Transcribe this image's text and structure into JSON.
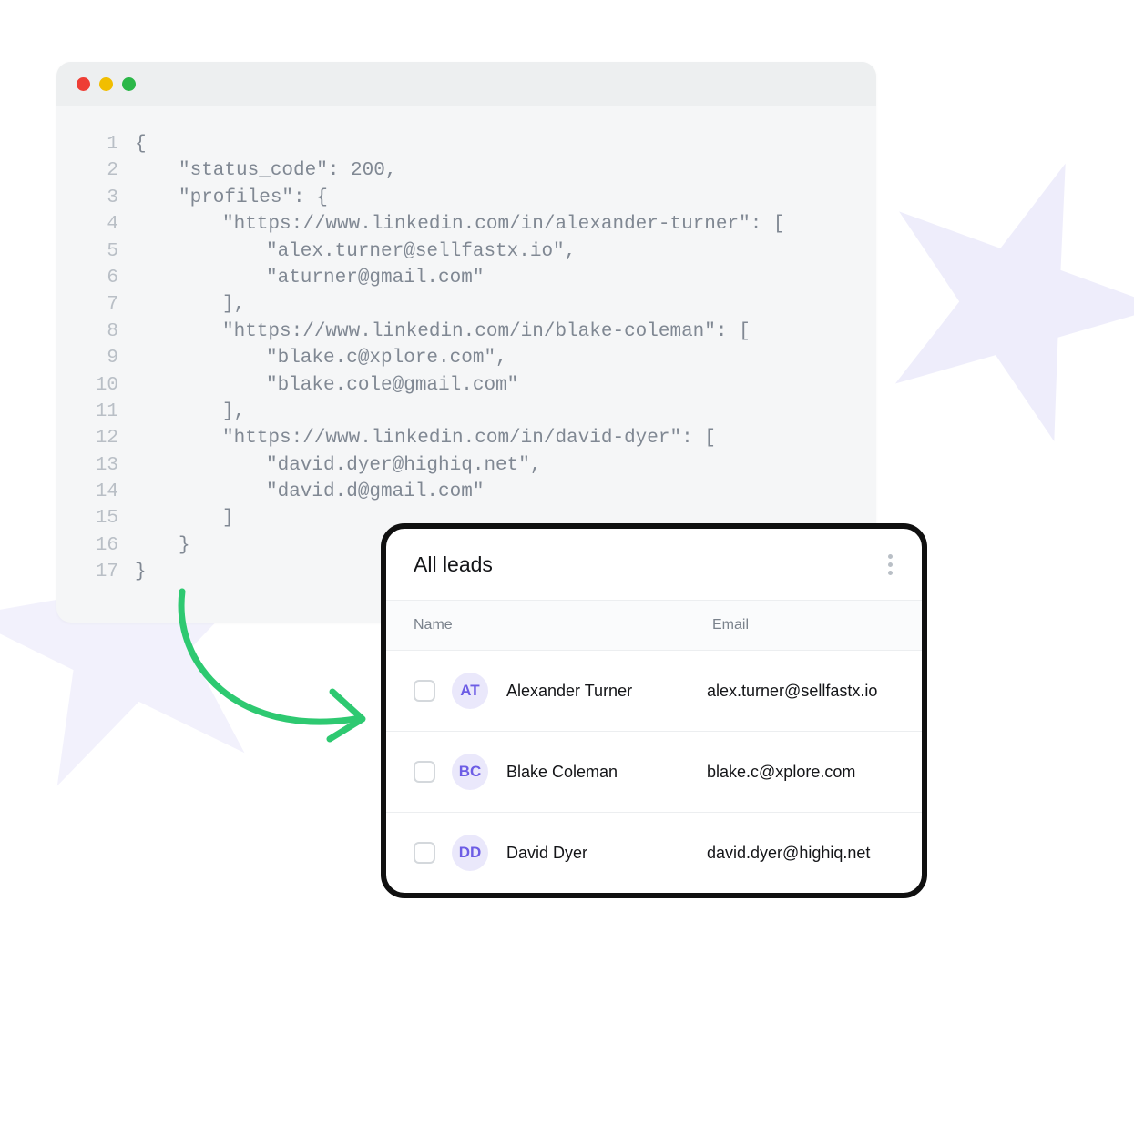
{
  "code": {
    "lines": [
      {
        "n": "1",
        "indent": 1,
        "text": "{"
      },
      {
        "n": "2",
        "indent": 2,
        "text": "\"status_code\": 200,"
      },
      {
        "n": "3",
        "indent": 2,
        "text": "\"profiles\": {"
      },
      {
        "n": "4",
        "indent": 3,
        "text": "\"https://www.linkedin.com/in/alexander-turner\": ["
      },
      {
        "n": "5",
        "indent": 4,
        "text": "\"alex.turner@sellfastx.io\","
      },
      {
        "n": "6",
        "indent": 4,
        "text": "\"aturner@gmail.com\""
      },
      {
        "n": "7",
        "indent": 3,
        "text": "],"
      },
      {
        "n": "8",
        "indent": 3,
        "text": "\"https://www.linkedin.com/in/blake-coleman\": ["
      },
      {
        "n": "9",
        "indent": 4,
        "text": "\"blake.c@xplore.com\","
      },
      {
        "n": "10",
        "indent": 4,
        "text": "\"blake.cole@gmail.com\""
      },
      {
        "n": "11",
        "indent": 3,
        "text": "],"
      },
      {
        "n": "12",
        "indent": 3,
        "text": "\"https://www.linkedin.com/in/david-dyer\": ["
      },
      {
        "n": "13",
        "indent": 4,
        "text": "\"david.dyer@highiq.net\","
      },
      {
        "n": "14",
        "indent": 4,
        "text": "\"david.d@gmail.com\""
      },
      {
        "n": "15",
        "indent": 3,
        "text": "]"
      },
      {
        "n": "16",
        "indent": 2,
        "text": "}"
      },
      {
        "n": "17",
        "indent": 1,
        "text": "}"
      }
    ]
  },
  "leads": {
    "title": "All leads",
    "columns": {
      "name": "Name",
      "email": "Email"
    },
    "rows": [
      {
        "initials": "AT",
        "name": "Alexander Turner",
        "email": "alex.turner@sellfastx.io"
      },
      {
        "initials": "BC",
        "name": "Blake Coleman",
        "email": "blake.c@xplore.com"
      },
      {
        "initials": "DD",
        "name": "David Dyer",
        "email": "david.dyer@highiq.net"
      }
    ]
  }
}
